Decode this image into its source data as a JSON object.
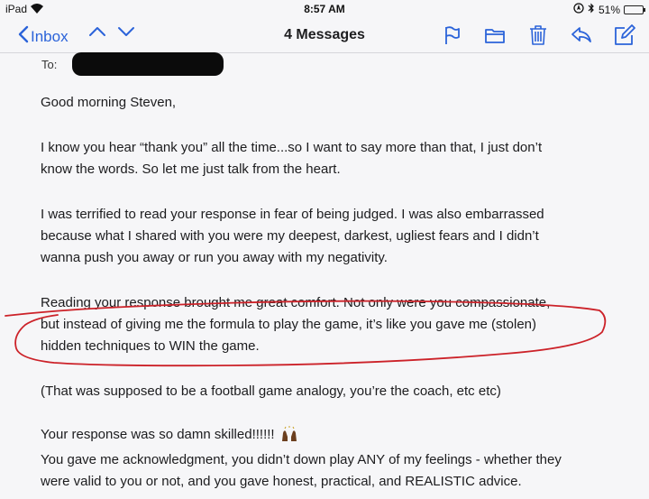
{
  "status_bar": {
    "device": "iPad",
    "time": "8:57 AM",
    "battery": "51%",
    "battery_level": 0.51
  },
  "nav": {
    "back_label": "Inbox",
    "title": "4 Messages",
    "icons": [
      "flag-icon",
      "folder-icon",
      "trash-icon",
      "reply-icon",
      "compose-icon"
    ]
  },
  "email": {
    "to_label": "To:",
    "greeting": "Good morning Steven,",
    "p1": [
      "I know you hear “thank you” all the time...so I want to say more than that, I just don’t",
      "know the words. So let me just talk from the heart."
    ],
    "p2": [
      "I was terrified to read your response in fear of being judged. I was also embarrassed",
      "because what I shared with you were my deepest, darkest, ugliest fears and I didn’t",
      "wanna push you away or run you away with my negativity."
    ],
    "p3": [
      "Reading your response brought me great comfort. Not only were you compassionate,",
      "but instead of giving me the formula to play the game, it’s like you gave me (stolen)",
      "hidden techniques to WIN the game."
    ],
    "p4": "(That was supposed to be a football game analogy, you’re the coach, etc etc)",
    "p5_line1": "Your response was so damn skilled!!!!!!",
    "p5": [
      "You gave me acknowledgment, you didn’t down play ANY of my feelings - whether they",
      "were valid to you or not, and you gave honest, practical, and REALISTIC advice."
    ]
  },
  "colors": {
    "accent": "#2b63d9",
    "ink": "#cc2229"
  }
}
